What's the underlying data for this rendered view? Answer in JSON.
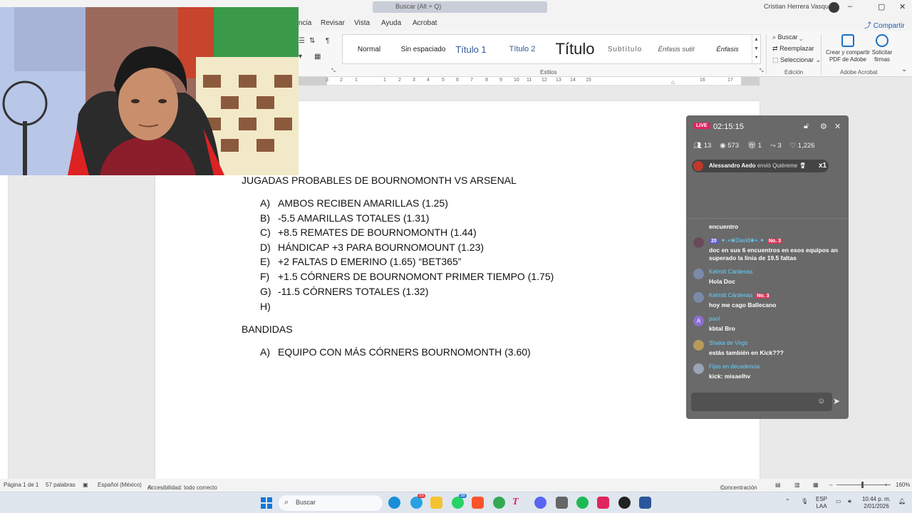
{
  "title_bar": {
    "search_placeholder": "Buscar (Alt + Q)",
    "user_name": "Cristian Herrera Vasquez"
  },
  "menu": {
    "tabs": [
      "ncia",
      "Revisar",
      "Vista",
      "Ayuda",
      "Acrobat"
    ],
    "share_label": "Compartir"
  },
  "ribbon": {
    "styles": [
      "Normal",
      "Sin espaciado",
      "Título 1",
      "Título 2",
      "Título",
      "Subtítulo",
      "Énfasis sutil",
      "Énfasis"
    ],
    "styles_group_label": "Estilos",
    "editing": {
      "find": "Buscar",
      "replace": "Reemplazar",
      "select": "Seleccionar",
      "group_label": "Edición"
    },
    "adobe": {
      "create_share": "Crear y compartir PDF de Adobe",
      "request_signatures": "Solicitar firmas",
      "group_label": "Adobe Acrobat"
    }
  },
  "ruler": {
    "numbers": [
      "3",
      "2",
      "1",
      "1",
      "2",
      "3",
      "4",
      "5",
      "6",
      "7",
      "8",
      "9",
      "10",
      "11",
      "12",
      "13",
      "14",
      "15",
      "16",
      "17"
    ]
  },
  "document": {
    "heading1": "JUGADAS PROBABLES DE BOURNOMONTH VS ARSENAL",
    "list1": [
      {
        "label": "A)",
        "text": "AMBOS RECIBEN AMARILLAS (1.25)"
      },
      {
        "label": "B)",
        "text": "-5.5 AMARILLAS TOTALES (1.31)"
      },
      {
        "label": "C)",
        "text": "+8.5 REMATES DE BOURNOMONTH (1.44)"
      },
      {
        "label": "D)",
        "text": "HÁNDICAP +3 PARA BOURNOMOUNT (1.23)"
      },
      {
        "label": "E)",
        "text": "+2 FALTAS D EMERINO (1.65) “BET365”"
      },
      {
        "label": "F)",
        "text": "+1.5 CÓRNERS DE BOURNOMONT PRIMER TIEMPO (1.75)"
      },
      {
        "label": "G)",
        "text": "-11.5 CÓRNERS TOTALES (1.32)"
      },
      {
        "label": "H)",
        "text": ""
      }
    ],
    "heading2": "BANDIDAS",
    "list2": [
      {
        "label": "A)",
        "text": "EQUIPO CON MÁS CÓRNERS BOURNOMONTH (3.60)"
      }
    ]
  },
  "chat": {
    "live_label": "LIVE",
    "timer": "02:15:15",
    "stats": {
      "users": "13",
      "viewers": "573",
      "gifts": "1",
      "shares": "3",
      "likes": "1,226"
    },
    "gift": {
      "user": "Alessandro Aedo",
      "action": "envió Quiéreme",
      "count": "x1"
    },
    "messages": [
      {
        "user": "",
        "text": "encuentro",
        "level": "",
        "badge": ""
      },
      {
        "user": "✦.+❀David❀+.✦",
        "text": "doc en sus 6 encuentros en esos equipos an superado la linia de 19.5 faltas",
        "level": "20",
        "badge": "No. 3"
      },
      {
        "user": "Kelmitt Cárdenas",
        "text": "Hola Doc",
        "level": "",
        "badge": ""
      },
      {
        "user": "Kelmitt Cárdenas",
        "text": "hoy me cago Ballecano",
        "level": "",
        "badge": "No. 3"
      },
      {
        "user": "pool",
        "text": "kbtal Bro",
        "level": "",
        "badge": ""
      },
      {
        "user": "Shaka de Virgo",
        "text": "estás también en Kick???",
        "level": "",
        "badge": ""
      },
      {
        "user": "Fijas en decadencia",
        "text": "kick: misaelhv",
        "level": "",
        "badge": ""
      }
    ]
  },
  "status_bar": {
    "page": "Página 1 de 1",
    "words": "57 palabras",
    "language": "Español (México)",
    "accessibility": "Accesibilidad: todo correcto",
    "focus": "Concentración",
    "zoom": "160%"
  },
  "taskbar": {
    "search_placeholder": "Buscar",
    "badges": {
      "telegram": "33",
      "whatsapp": "38"
    },
    "language": "ESP",
    "keyboard": "LAA",
    "time": "10:44 p. m.",
    "date": "2/01/2026"
  },
  "colors": {
    "accent": "#1a5fb4",
    "live": "#e0245e",
    "chat_user": "#63d0ff"
  }
}
